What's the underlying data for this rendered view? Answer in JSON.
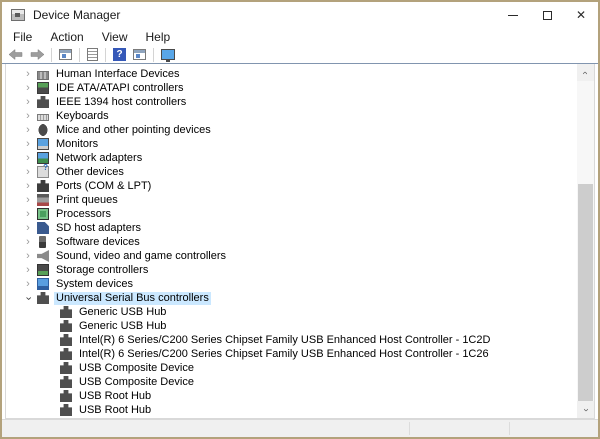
{
  "window": {
    "title": "Device Manager"
  },
  "menu": {
    "items": [
      "File",
      "Action",
      "View",
      "Help"
    ]
  },
  "toolbar": {
    "buttons": [
      "back-button",
      "forward-button",
      "console-tree-button",
      "properties-button",
      "help-button",
      "action-pane-button",
      "scan-hardware-changes-button"
    ]
  },
  "tree": {
    "items": [
      {
        "label": "Human Interface Devices",
        "icon": "hid",
        "level": 0,
        "expandable": true,
        "expanded": false,
        "selected": false
      },
      {
        "label": "IDE ATA/ATAPI controllers",
        "icon": "ide",
        "level": 0,
        "expandable": true,
        "expanded": false,
        "selected": false
      },
      {
        "label": "IEEE 1394 host controllers",
        "icon": "ieee1394",
        "level": 0,
        "expandable": true,
        "expanded": false,
        "selected": false
      },
      {
        "label": "Keyboards",
        "icon": "keyboard",
        "level": 0,
        "expandable": true,
        "expanded": false,
        "selected": false
      },
      {
        "label": "Mice and other pointing devices",
        "icon": "mouse",
        "level": 0,
        "expandable": true,
        "expanded": false,
        "selected": false
      },
      {
        "label": "Monitors",
        "icon": "monitor",
        "level": 0,
        "expandable": true,
        "expanded": false,
        "selected": false
      },
      {
        "label": "Network adapters",
        "icon": "network",
        "level": 0,
        "expandable": true,
        "expanded": false,
        "selected": false
      },
      {
        "label": "Other devices",
        "icon": "unknown-device",
        "level": 0,
        "expandable": true,
        "expanded": false,
        "selected": false
      },
      {
        "label": "Ports (COM & LPT)",
        "icon": "serial-port",
        "level": 0,
        "expandable": true,
        "expanded": false,
        "selected": false
      },
      {
        "label": "Print queues",
        "icon": "printer",
        "level": 0,
        "expandable": true,
        "expanded": false,
        "selected": false
      },
      {
        "label": "Processors",
        "icon": "processor",
        "level": 0,
        "expandable": true,
        "expanded": false,
        "selected": false
      },
      {
        "label": "SD host adapters",
        "icon": "sd-card",
        "level": 0,
        "expandable": true,
        "expanded": false,
        "selected": false
      },
      {
        "label": "Software devices",
        "icon": "software",
        "level": 0,
        "expandable": true,
        "expanded": false,
        "selected": false
      },
      {
        "label": "Sound, video and game controllers",
        "icon": "speaker",
        "level": 0,
        "expandable": true,
        "expanded": false,
        "selected": false
      },
      {
        "label": "Storage controllers",
        "icon": "storage",
        "level": 0,
        "expandable": true,
        "expanded": false,
        "selected": false
      },
      {
        "label": "System devices",
        "icon": "system",
        "level": 0,
        "expandable": true,
        "expanded": false,
        "selected": false
      },
      {
        "label": "Universal Serial Bus controllers",
        "icon": "usb",
        "level": 0,
        "expandable": true,
        "expanded": true,
        "selected": true
      },
      {
        "label": "Generic USB Hub",
        "icon": "usb",
        "level": 1,
        "expandable": false,
        "expanded": false,
        "selected": false
      },
      {
        "label": "Generic USB Hub",
        "icon": "usb",
        "level": 1,
        "expandable": false,
        "expanded": false,
        "selected": false
      },
      {
        "label": "Intel(R) 6 Series/C200 Series Chipset Family USB Enhanced Host Controller - 1C2D",
        "icon": "usb",
        "level": 1,
        "expandable": false,
        "expanded": false,
        "selected": false
      },
      {
        "label": "Intel(R) 6 Series/C200 Series Chipset Family USB Enhanced Host Controller - 1C26",
        "icon": "usb",
        "level": 1,
        "expandable": false,
        "expanded": false,
        "selected": false
      },
      {
        "label": "USB Composite Device",
        "icon": "usb",
        "level": 1,
        "expandable": false,
        "expanded": false,
        "selected": false
      },
      {
        "label": "USB Composite Device",
        "icon": "usb",
        "level": 1,
        "expandable": false,
        "expanded": false,
        "selected": false
      },
      {
        "label": "USB Root Hub",
        "icon": "usb",
        "level": 1,
        "expandable": false,
        "expanded": false,
        "selected": false
      },
      {
        "label": "USB Root Hub",
        "icon": "usb",
        "level": 1,
        "expandable": false,
        "expanded": false,
        "selected": false
      }
    ]
  },
  "colors": {
    "window_border": "#b3a27c",
    "selection_highlight": "#cbe8ff",
    "toolbar_divider": "#8195af",
    "help_button_blue": "#3558b8",
    "statusbar_bg": "#f0f0f0",
    "scrollbar_thumb": "#cdcdcd"
  }
}
